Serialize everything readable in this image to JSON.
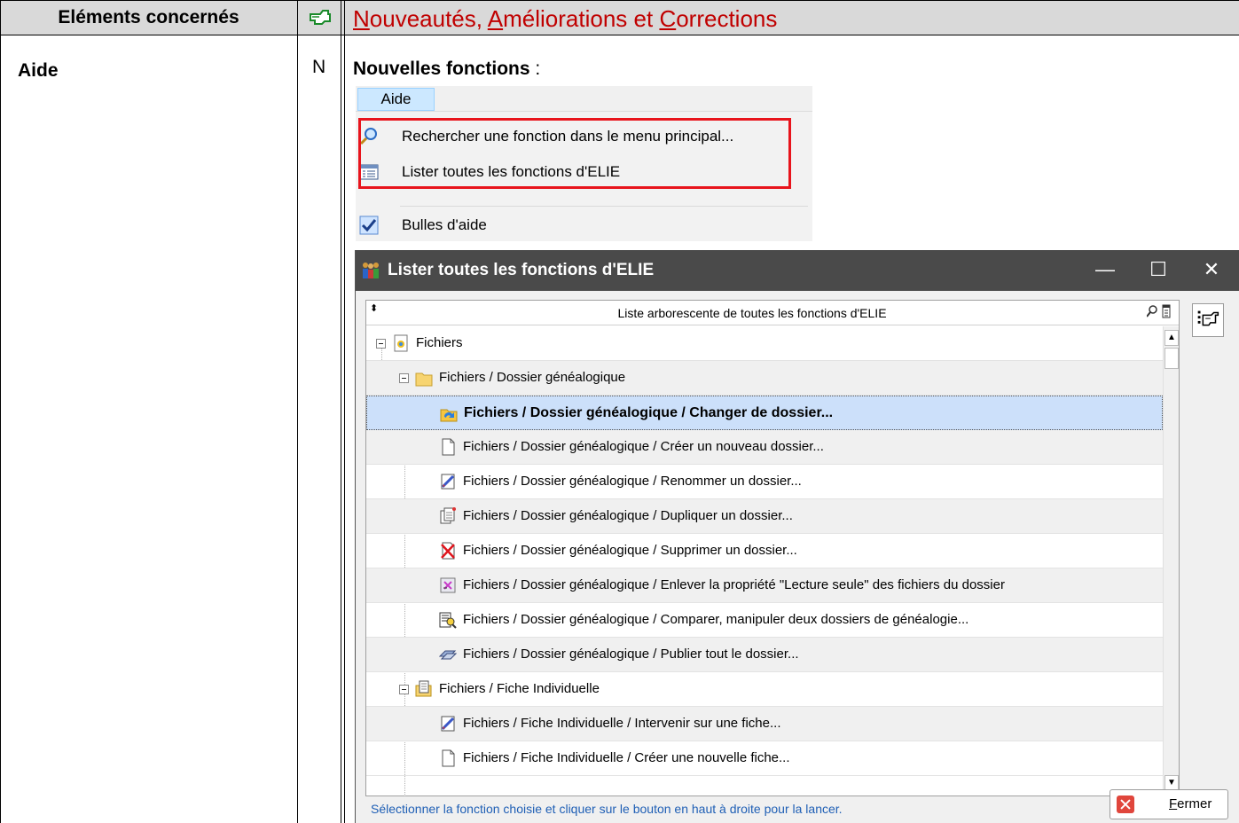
{
  "doc": {
    "col_elements_header": "Eléments concernés",
    "col_changes_header_parts": [
      "N",
      "ouveautés, ",
      "A",
      "méliorations et ",
      "C",
      "orrections"
    ],
    "row": {
      "element": "Aide",
      "type": "N",
      "heading_bold": "Nouvelles fonctions",
      "heading_rest": " :"
    }
  },
  "menu": {
    "menu_title": "Aide",
    "items": [
      {
        "icon": "magnifier-icon",
        "label": "Rechercher une fonction dans le menu principal..."
      },
      {
        "icon": "list-icon",
        "label": "Lister toutes les fonctions d'ELIE"
      },
      {
        "icon": "checked-bubble-icon",
        "label": "Bulles d'aide"
      }
    ]
  },
  "dialog": {
    "title": "Lister toutes les fonctions d'ELIE",
    "window_buttons": {
      "minimize": "—",
      "maximize": "☐",
      "close": "✕"
    },
    "list_header": "Liste arborescente de toutes les fonctions d'ELIE",
    "rows": [
      {
        "level": 0,
        "icon": "file-star-icon",
        "expander": true,
        "label": "Fichiers"
      },
      {
        "level": 1,
        "icon": "folder-icon",
        "expander": true,
        "label": "Fichiers / Dossier généalogique"
      },
      {
        "level": 2,
        "icon": "change-folder-icon",
        "selected": true,
        "label": "Fichiers / Dossier généalogique / Changer de dossier..."
      },
      {
        "level": 2,
        "icon": "blank-page-icon",
        "label": "Fichiers / Dossier généalogique / Créer un nouveau dossier..."
      },
      {
        "level": 2,
        "icon": "rename-icon",
        "label": "Fichiers / Dossier généalogique / Renommer un dossier..."
      },
      {
        "level": 2,
        "icon": "duplicate-icon",
        "label": "Fichiers / Dossier généalogique / Dupliquer un dossier..."
      },
      {
        "level": 2,
        "icon": "delete-icon",
        "label": "Fichiers / Dossier généalogique / Supprimer un dossier..."
      },
      {
        "level": 2,
        "icon": "readonly-icon",
        "label": "Fichiers / Dossier généalogique / Enlever la propriété \"Lecture seule\" des fichiers du dossier"
      },
      {
        "level": 2,
        "icon": "compare-icon",
        "label": "Fichiers / Dossier généalogique / Comparer, manipuler deux dossiers de généalogie..."
      },
      {
        "level": 2,
        "icon": "publish-icon",
        "label": "Fichiers / Dossier généalogique / Publier tout le dossier..."
      },
      {
        "level": 1,
        "icon": "card-icon",
        "expander": true,
        "label": "Fichiers / Fiche Individuelle"
      },
      {
        "level": 2,
        "icon": "rename-icon",
        "label": "Fichiers / Fiche Individuelle / Intervenir sur une fiche..."
      },
      {
        "level": 2,
        "icon": "blank-page-icon",
        "label": "Fichiers / Fiche Individuelle / Créer une nouvelle fiche..."
      }
    ],
    "status_text": "Sélectionner la fonction choisie et cliquer sur le bouton en haut à droite pour la lancer.",
    "close_label": "Fermer",
    "colors": {
      "title_bar": "#4a4a4a",
      "selection": "#cce0fa",
      "status_text": "#1f5fb5",
      "heading": "#c00000",
      "highlight_box": "#e8141c"
    }
  }
}
